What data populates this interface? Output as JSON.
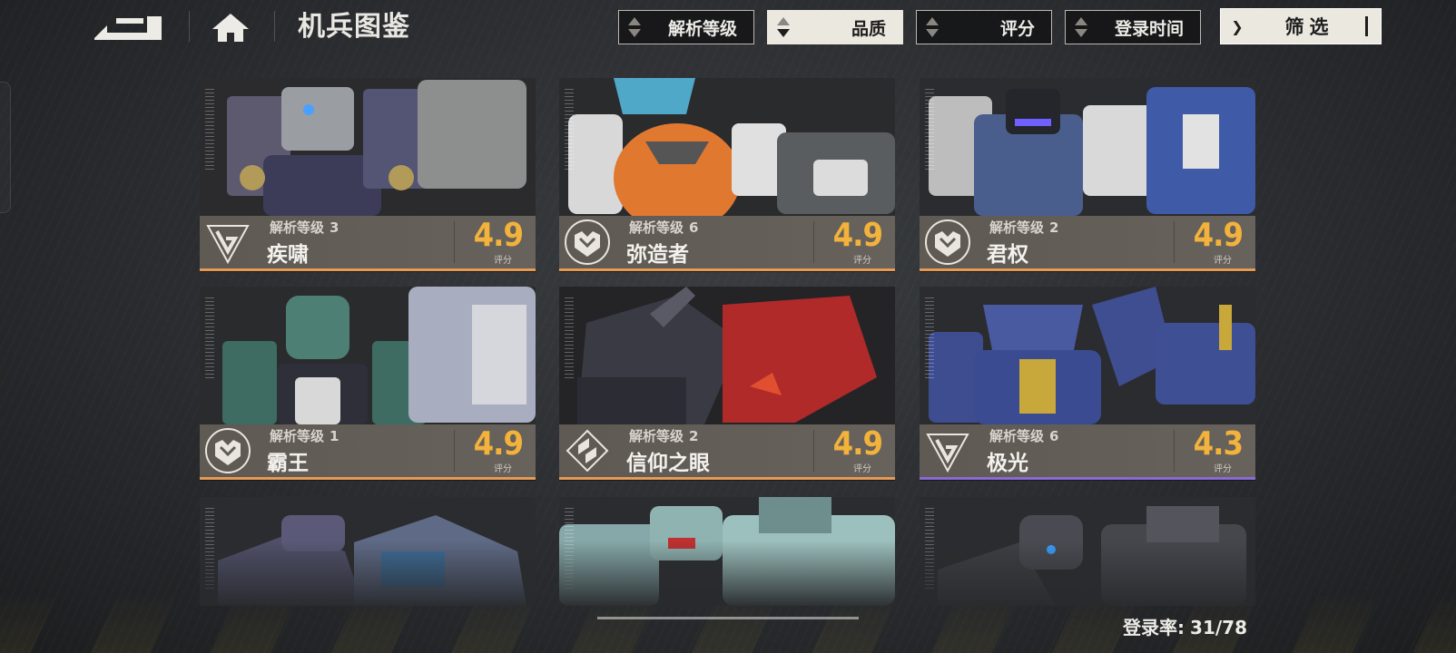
{
  "header": {
    "title": "机兵图鉴",
    "sort_buttons": [
      {
        "label": "解析等级",
        "active": false
      },
      {
        "label": "品质",
        "active": true
      },
      {
        "label": "评分",
        "active": false
      },
      {
        "label": "登录时间",
        "active": false
      }
    ],
    "filter_label": "筛选"
  },
  "cards": [
    {
      "level_label": "解析等级",
      "level": "3",
      "name": "疾啸",
      "score": "4.9",
      "score_label": "评分",
      "emblem": "triangle-emblem-icon",
      "accent": "#e59a55"
    },
    {
      "level_label": "解析等级",
      "level": "6",
      "name": "弥造者",
      "score": "4.9",
      "score_label": "评分",
      "emblem": "m-shield-emblem-icon",
      "accent": "#e59a55"
    },
    {
      "level_label": "解析等级",
      "level": "2",
      "name": "君权",
      "score": "4.9",
      "score_label": "评分",
      "emblem": "m-shield-emblem-icon",
      "accent": "#e59a55"
    },
    {
      "level_label": "解析等级",
      "level": "1",
      "name": "霸王",
      "score": "4.9",
      "score_label": "评分",
      "emblem": "m-shield-emblem-icon",
      "accent": "#e59a55"
    },
    {
      "level_label": "解析等级",
      "level": "2",
      "name": "信仰之眼",
      "score": "4.9",
      "score_label": "评分",
      "emblem": "diamond-emblem-icon",
      "accent": "#e59a55"
    },
    {
      "level_label": "解析等级",
      "level": "6",
      "name": "极光",
      "score": "4.3",
      "score_label": "评分",
      "emblem": "triangle-emblem-icon",
      "accent": "#8a6ad6"
    }
  ],
  "footer": {
    "rate_label": "登录率:",
    "rate_value": "31/78"
  },
  "colors": {
    "score": "#f2b23c",
    "accent_orange": "#e59a55",
    "accent_purple": "#8a6ad6"
  }
}
